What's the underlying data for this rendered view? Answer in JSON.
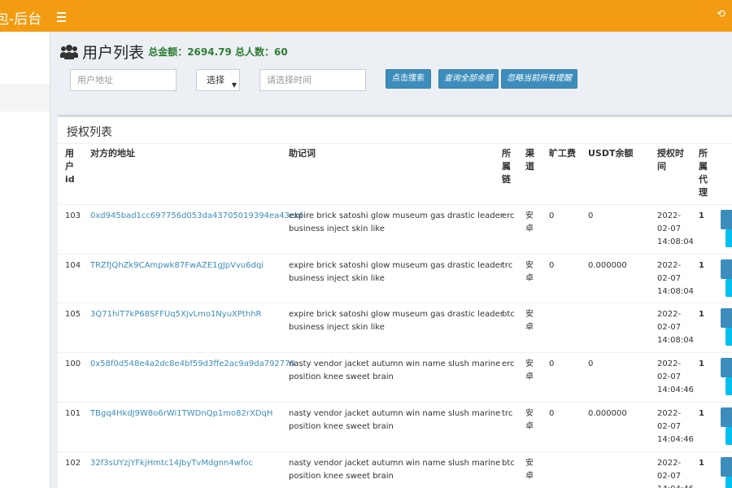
{
  "header": {
    "brand": "包-后台",
    "logout_glyph": "⟲"
  },
  "page": {
    "title": "用户列表",
    "stats": "总金额：2694.79 总人数：60"
  },
  "filters": {
    "address_placeholder": "用户地址",
    "select_value": "选择",
    "time_placeholder": "请选择时间",
    "search_label": "点击搜索",
    "query_balance_label": "查询全部余额",
    "ignore_alerts_label": "忽略当前所有提醒"
  },
  "table": {
    "title": "授权列表",
    "headers": [
      "用户id",
      "对方的地址",
      "助记词",
      "所属链",
      "渠道",
      "旷工费",
      "USDT余额",
      "授权时间",
      "所属代理"
    ],
    "rows": [
      {
        "id": "103",
        "address": "0xd945bad1cc697756d053da43705019394ea43ebf",
        "mnemonic_1": "expire brick satoshi glow museum gas drastic leader",
        "mnemonic_2": "business inject skin like",
        "chain": "erc",
        "channel_1": "安",
        "channel_2": "卓",
        "fee": "0",
        "usdt": "0",
        "date_1": "2022-",
        "date_2": "02-07",
        "date_3": "14:08:04",
        "agent": "1"
      },
      {
        "id": "104",
        "address": "TRZfJQhZk9CAmpwk87FwAZE1gJpVvu6dqi",
        "mnemonic_1": "expire brick satoshi glow museum gas drastic leader",
        "mnemonic_2": "business inject skin like",
        "chain": "trc",
        "channel_1": "安",
        "channel_2": "卓",
        "fee": "0",
        "usdt": "0.000000",
        "date_1": "2022-",
        "date_2": "02-07",
        "date_3": "14:08:04",
        "agent": "1"
      },
      {
        "id": "105",
        "address": "3Q71hiT7kP68SFFUq5XjvLmo1NyuXPthhR",
        "mnemonic_1": "expire brick satoshi glow museum gas drastic leader",
        "mnemonic_2": "business inject skin like",
        "chain": "btc",
        "channel_1": "安",
        "channel_2": "卓",
        "fee": "",
        "usdt": "",
        "date_1": "2022-",
        "date_2": "02-07",
        "date_3": "14:08:04",
        "agent": "1"
      },
      {
        "id": "100",
        "address": "0x58f0d548e4a2dc8e4bf59d3ffe2ac9a9da792770",
        "mnemonic_1": "nasty vendor jacket autumn win name slush marine",
        "mnemonic_2": "position knee sweet brain",
        "chain": "erc",
        "channel_1": "安",
        "channel_2": "卓",
        "fee": "0",
        "usdt": "0",
        "date_1": "2022-",
        "date_2": "02-07",
        "date_3": "14:04:46",
        "agent": "1"
      },
      {
        "id": "101",
        "address": "TBgq4HkdJ9W8o6rWi1TWDnQp1mo82rXDqH",
        "mnemonic_1": "nasty vendor jacket autumn win name slush marine",
        "mnemonic_2": "position knee sweet brain",
        "chain": "trc",
        "channel_1": "安",
        "channel_2": "卓",
        "fee": "0",
        "usdt": "0.000000",
        "date_1": "2022-",
        "date_2": "02-07",
        "date_3": "14:04:46",
        "agent": "1"
      },
      {
        "id": "102",
        "address": "32f3sUYzjYFkjHmtc14JbyTvMdgnn4wfoc",
        "mnemonic_1": "nasty vendor jacket autumn win name slush marine",
        "mnemonic_2": "position knee sweet brain",
        "chain": "btc",
        "channel_1": "安",
        "channel_2": "卓",
        "fee": "",
        "usdt": "",
        "date_1": "2022-",
        "date_2": "02-07",
        "date_3": "14:04:46",
        "agent": "1"
      }
    ]
  },
  "colors": {
    "topbar": "#f39c12",
    "primary": "#3c8dbc",
    "info": "#00c0ef",
    "stat": "#2e7d32"
  }
}
